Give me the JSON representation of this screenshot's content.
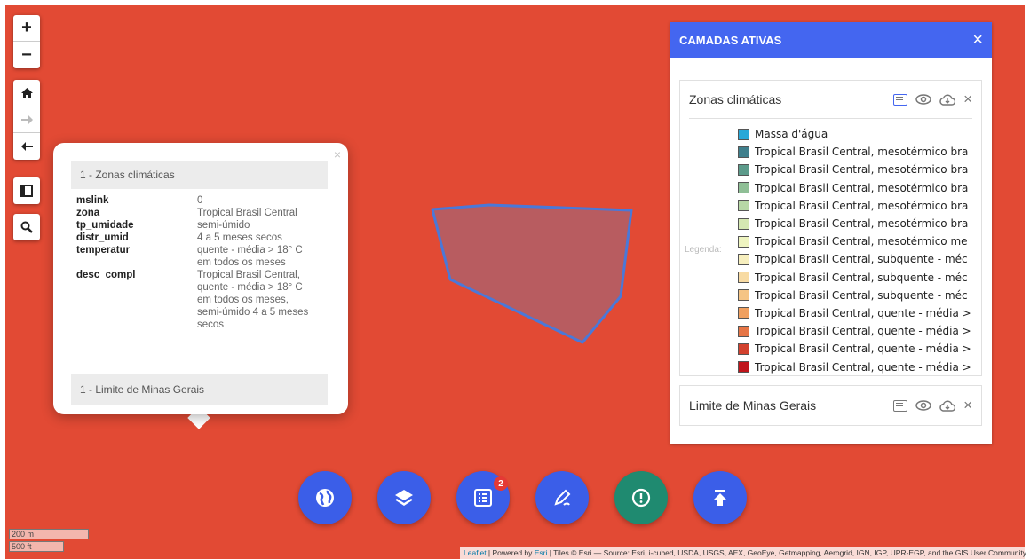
{
  "map_controls": {
    "zoom_in": "+",
    "zoom_out": "−",
    "home_icon": "home-icon",
    "forward_icon": "arrow-right-icon",
    "back_icon": "arrow-left-icon",
    "fullscreen_icon": "fullscreen-icon",
    "search_icon": "search-icon"
  },
  "popup": {
    "close": "×",
    "section1_title": "1 - Zonas climáticas",
    "attributes": [
      {
        "key": "mslink",
        "value": "0"
      },
      {
        "key": "zona",
        "value": "Tropical Brasil Central"
      },
      {
        "key": "tp_umidade",
        "value": "semi-úmido"
      },
      {
        "key": "distr_umid",
        "value": "4 a 5 meses secos"
      },
      {
        "key": "temperatur",
        "value": "quente - média > 18° C em todos os meses"
      },
      {
        "key": "desc_compl",
        "value": "Tropical Brasil Central, quente - média > 18° C em todos os meses, semi-úmido 4 a 5 meses secos"
      }
    ],
    "section2_title": "1 - Limite de Minas Gerais"
  },
  "layers_panel": {
    "title": "CAMADAS ATIVAS",
    "close": "×",
    "legend_label": "Legenda:",
    "layers": [
      {
        "name": "Zonas climáticas"
      },
      {
        "name": "Limite de Minas Gerais"
      }
    ],
    "legend_items": [
      {
        "label": "Massa d'água",
        "color": "#29a8d8"
      },
      {
        "label": "Tropical Brasil Central, mesotérmico bra",
        "color": "#3f7f8c"
      },
      {
        "label": "Tropical Brasil Central, mesotérmico bra",
        "color": "#5c9a8a"
      },
      {
        "label": "Tropical Brasil Central, mesotérmico bra",
        "color": "#8fbf96"
      },
      {
        "label": "Tropical Brasil Central, mesotérmico bra",
        "color": "#b7d8a6"
      },
      {
        "label": "Tropical Brasil Central, mesotérmico bra",
        "color": "#d5e8b2"
      },
      {
        "label": "Tropical Brasil Central, mesotérmico me",
        "color": "#eef4c0"
      },
      {
        "label": "Tropical Brasil Central, subquente - méc",
        "color": "#f7efbe"
      },
      {
        "label": "Tropical Brasil Central, subquente - méc",
        "color": "#f8dba3"
      },
      {
        "label": "Tropical Brasil Central, subquente - méc",
        "color": "#f5c484"
      },
      {
        "label": "Tropical Brasil Central, quente - média >",
        "color": "#f0a060"
      },
      {
        "label": "Tropical Brasil Central, quente - média >",
        "color": "#e67545"
      },
      {
        "label": "Tropical Brasil Central, quente - média >",
        "color": "#d2412e"
      },
      {
        "label": "Tropical Brasil Central, quente - média >",
        "color": "#c0151c"
      }
    ]
  },
  "toolbar": {
    "badge_count": "2",
    "buttons": [
      "globe-icon",
      "layers-icon",
      "list-icon",
      "draw-icon",
      "alert-icon",
      "upload-icon"
    ]
  },
  "scale": {
    "metric": "200 m",
    "imperial": "500 ft"
  },
  "attribution": {
    "leaflet": "Leaflet",
    "powered": " | Powered by ",
    "esri": "Esri",
    "rest": " | Tiles © Esri — Source: Esri, i-cubed, USDA, USGS, AEX, GeoEye, Getmapping, Aerogrid, IGN, IGP, UPR-EGP, and the GIS User Community"
  },
  "colors": {
    "map_bg": "#e24a34",
    "polygon_fill": "#b85c60",
    "polygon_stroke": "#4a78d8",
    "header": "#4466f0",
    "fab": "#3b5ee8",
    "fab_teal": "#1f8a70"
  }
}
